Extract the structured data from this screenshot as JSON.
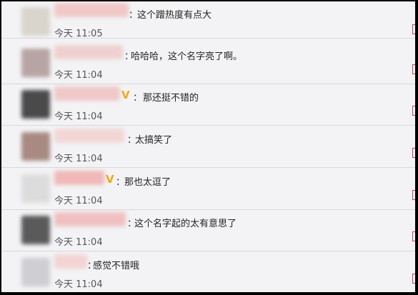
{
  "comments": [
    {
      "text": "这个蹭热度有点大",
      "time": "今天 11:05",
      "vip": false
    },
    {
      "text": "哈哈哈，这个名字亮了啊。",
      "time": "今天 11:04",
      "vip": false
    },
    {
      "text": "那还挺不错的",
      "time": "今天 11:04",
      "vip": true
    },
    {
      "text": "太搞笑了",
      "time": "今天 11:04",
      "vip": false
    },
    {
      "text": "那也太逗了",
      "time": "今天 11:04",
      "vip": true
    },
    {
      "text": "这个名字起的太有意思了",
      "time": "今天 11:04",
      "vip": false
    },
    {
      "text": "感觉不错哦",
      "time": "今天 11:04",
      "vip": false
    }
  ],
  "vip_symbol": "V",
  "colon": "：",
  "colors": {
    "vip": "#f0a81c",
    "name_blur": "#f0c8c8",
    "edge": "#c6435f"
  }
}
